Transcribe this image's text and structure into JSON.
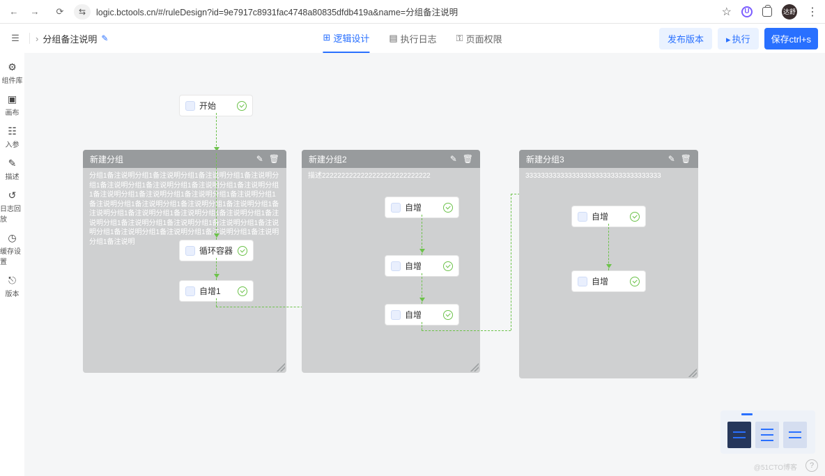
{
  "browser": {
    "url": "logic.bctools.cn/#/ruleDesign?id=9e7917c8931fac4748a80835dfdb419a&name=分组备注说明",
    "purple_badge": "U",
    "avatar_text": "达舒"
  },
  "header": {
    "page_title": "分组备注说明",
    "tabs": [
      {
        "label": "逻辑设计",
        "icon": "⊞",
        "active": true
      },
      {
        "label": "执行日志",
        "icon": "▤",
        "active": false
      },
      {
        "label": "页面权限",
        "icon": "⚿",
        "active": false
      }
    ],
    "publish_btn": "发布版本",
    "run_btn": "执行",
    "save_btn": "保存ctrl+s"
  },
  "sidebar": [
    {
      "icon": "⚙",
      "label": "组件库"
    },
    {
      "icon": "▣",
      "label": "画布"
    },
    {
      "icon": "☷",
      "label": "入参"
    },
    {
      "icon": "✎",
      "label": "描述"
    },
    {
      "icon": "↺",
      "label": "日志回放"
    },
    {
      "icon": "◷",
      "label": "缓存设置"
    },
    {
      "icon": "⎋",
      "label": "版本"
    }
  ],
  "canvas": {
    "start_node": {
      "label": "开始"
    },
    "groups": [
      {
        "title": "新建分组",
        "description": "分组1备注说明分组1备注说明分组1备注说明分组1备注说明分组1备注说明分组1备注说明分组1备注说明分组1备注说明分组1备注说明分组1备注说明分组1备注说明分组1备注说明分组1备注说明分组1备注说明分组1备注说明分组1备注说明分组1备注说明分组1备注说明分组1备注说明分组1备注说明分组1备注说明分组1备注说明分组1备注说明分组1备注说明分组1备注说明分组1备注说明分组1备注说明分组1备注说明分组1备注说明分组1备注说明",
        "nodes": [
          {
            "label": "循环容器"
          },
          {
            "label": "自增1"
          }
        ]
      },
      {
        "title": "新建分组2",
        "description": "描述2222222222222222222222222222",
        "nodes": [
          {
            "label": "自增"
          },
          {
            "label": "自增"
          },
          {
            "label": "自增"
          }
        ]
      },
      {
        "title": "新建分组3",
        "description": "33333333333333333333333333333333333",
        "nodes": [
          {
            "label": "自增"
          },
          {
            "label": "自增"
          }
        ]
      }
    ]
  },
  "footer": {
    "watermark": "@51CTO博客"
  }
}
